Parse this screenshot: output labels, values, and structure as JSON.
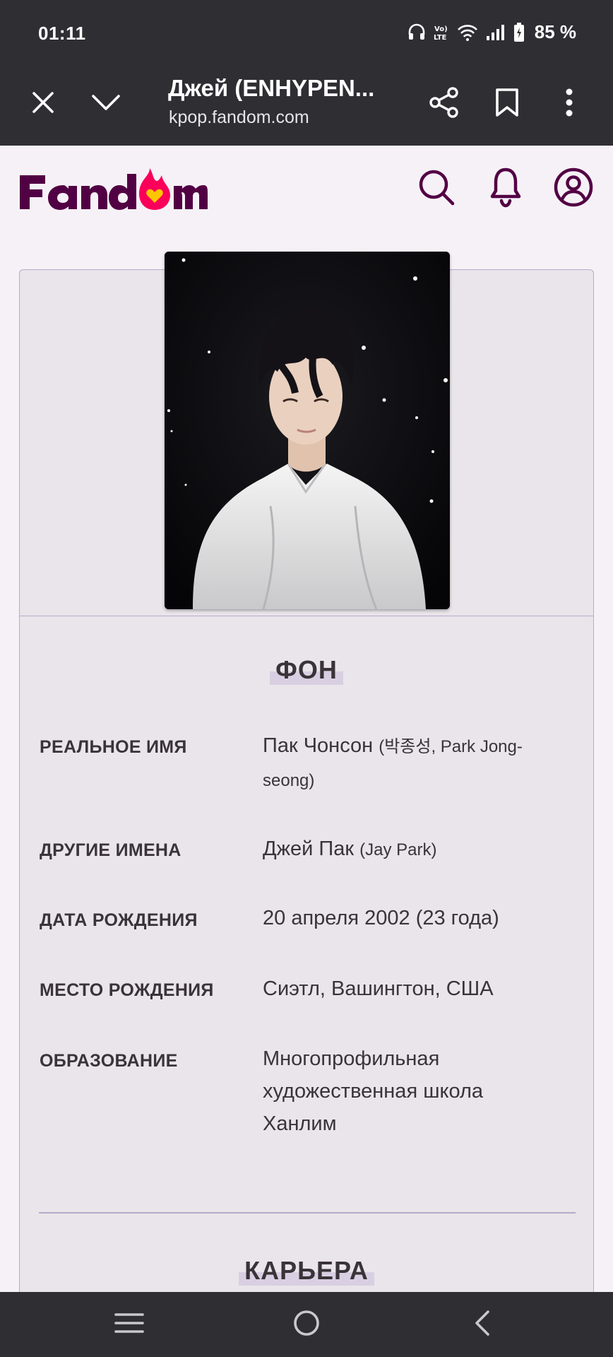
{
  "status_bar": {
    "time": "01:11",
    "battery": "85 %",
    "icons": [
      "headphones-icon",
      "volte-icon",
      "wifi-icon",
      "signal-icon",
      "battery-icon"
    ]
  },
  "browser": {
    "title": "Джей (ENHYPEN...",
    "url": "kpop.fandom.com",
    "icons": [
      "close-icon",
      "chevron-down-icon",
      "share-icon",
      "bookmark-icon",
      "more-vert-icon"
    ]
  },
  "fandom": {
    "logo_text": "Fandom",
    "icons": [
      "search-icon",
      "bell-icon",
      "user-icon"
    ],
    "colors": {
      "brand": "#520044",
      "flame": "#fa005a",
      "heart": "#ffc500"
    }
  },
  "infobox": {
    "section_title": "ФОН",
    "rows": [
      {
        "label": "РЕАЛЬНОЕ ИМЯ",
        "value": "Пак Чонсон",
        "value_small": "(박종성, Park Jong-seong)"
      },
      {
        "label": "ДРУГИЕ ИМЕНА",
        "value": "Джей Пак",
        "value_small": "(Jay Park)"
      },
      {
        "label": "ДАТА РОЖДЕНИЯ",
        "value": "20 апреля 2002 (23 года)"
      },
      {
        "label": "МЕСТО РОЖДЕНИЯ",
        "value": "Сиэтл, Вашингтон, США"
      },
      {
        "label": "ОБРАЗОВАНИЕ",
        "value": "Многопрофильная художественная школа Ханлим"
      }
    ],
    "next_section_title": "КАРЬЕРА"
  },
  "nav": {
    "icons": [
      "recent-apps-icon",
      "home-icon",
      "back-icon"
    ]
  }
}
